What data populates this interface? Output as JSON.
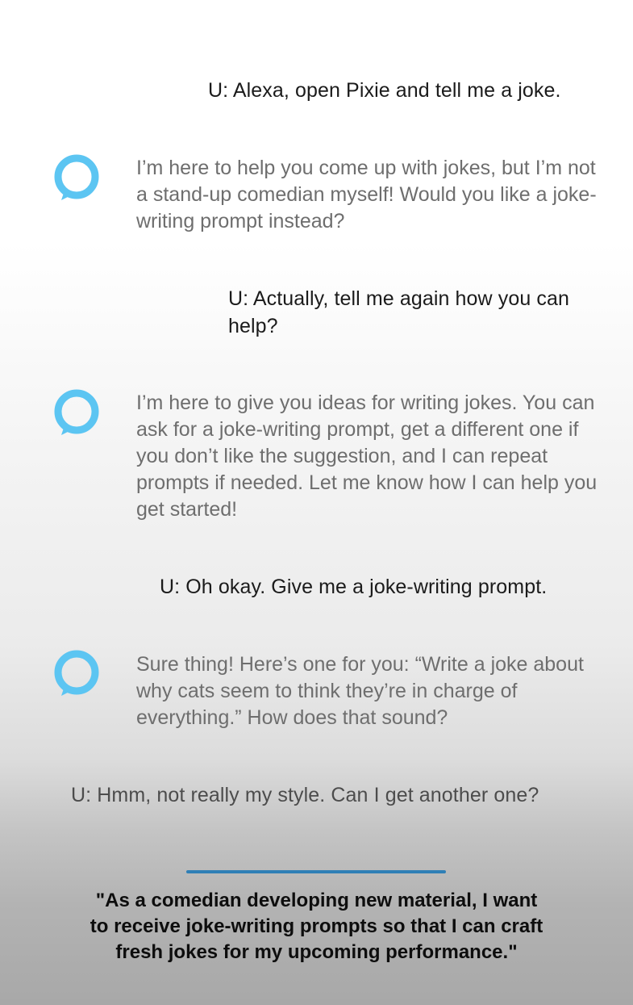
{
  "colors": {
    "alexa_ring": "#5cc5f2",
    "user_text": "#1b1b1b",
    "assistant_text": "#6e6e6e",
    "divider": "#2f7fb6"
  },
  "conversation": {
    "user_1": "U: Alexa, open Pixie and tell me a joke.",
    "assistant_1": "I’m here to help you come up with jokes, but I’m not a stand-up comedian myself! Would you like a joke-writing prompt instead?",
    "user_2": "U: Actually, tell me again how you can help?",
    "assistant_2": "I’m here to give you ideas for writing jokes. You can ask for a joke-writing prompt, get a different one if you don’t like the suggestion, and I can repeat prompts if needed. Let me know how I can help you get started!",
    "user_3": "U: Oh okay. Give me a joke-writing prompt.",
    "assistant_3": "Sure thing! Here’s one for you: “Write a joke about why cats seem to think they’re in charge of everything.” How does that sound?",
    "user_4": "U: Hmm, not really my style. Can I get another one?"
  },
  "assistant_icon": "alexa-ring-icon",
  "user_story": "\"As a comedian developing new material, I want to receive joke-writing prompts so that I can craft fresh jokes for my upcoming performance.\""
}
